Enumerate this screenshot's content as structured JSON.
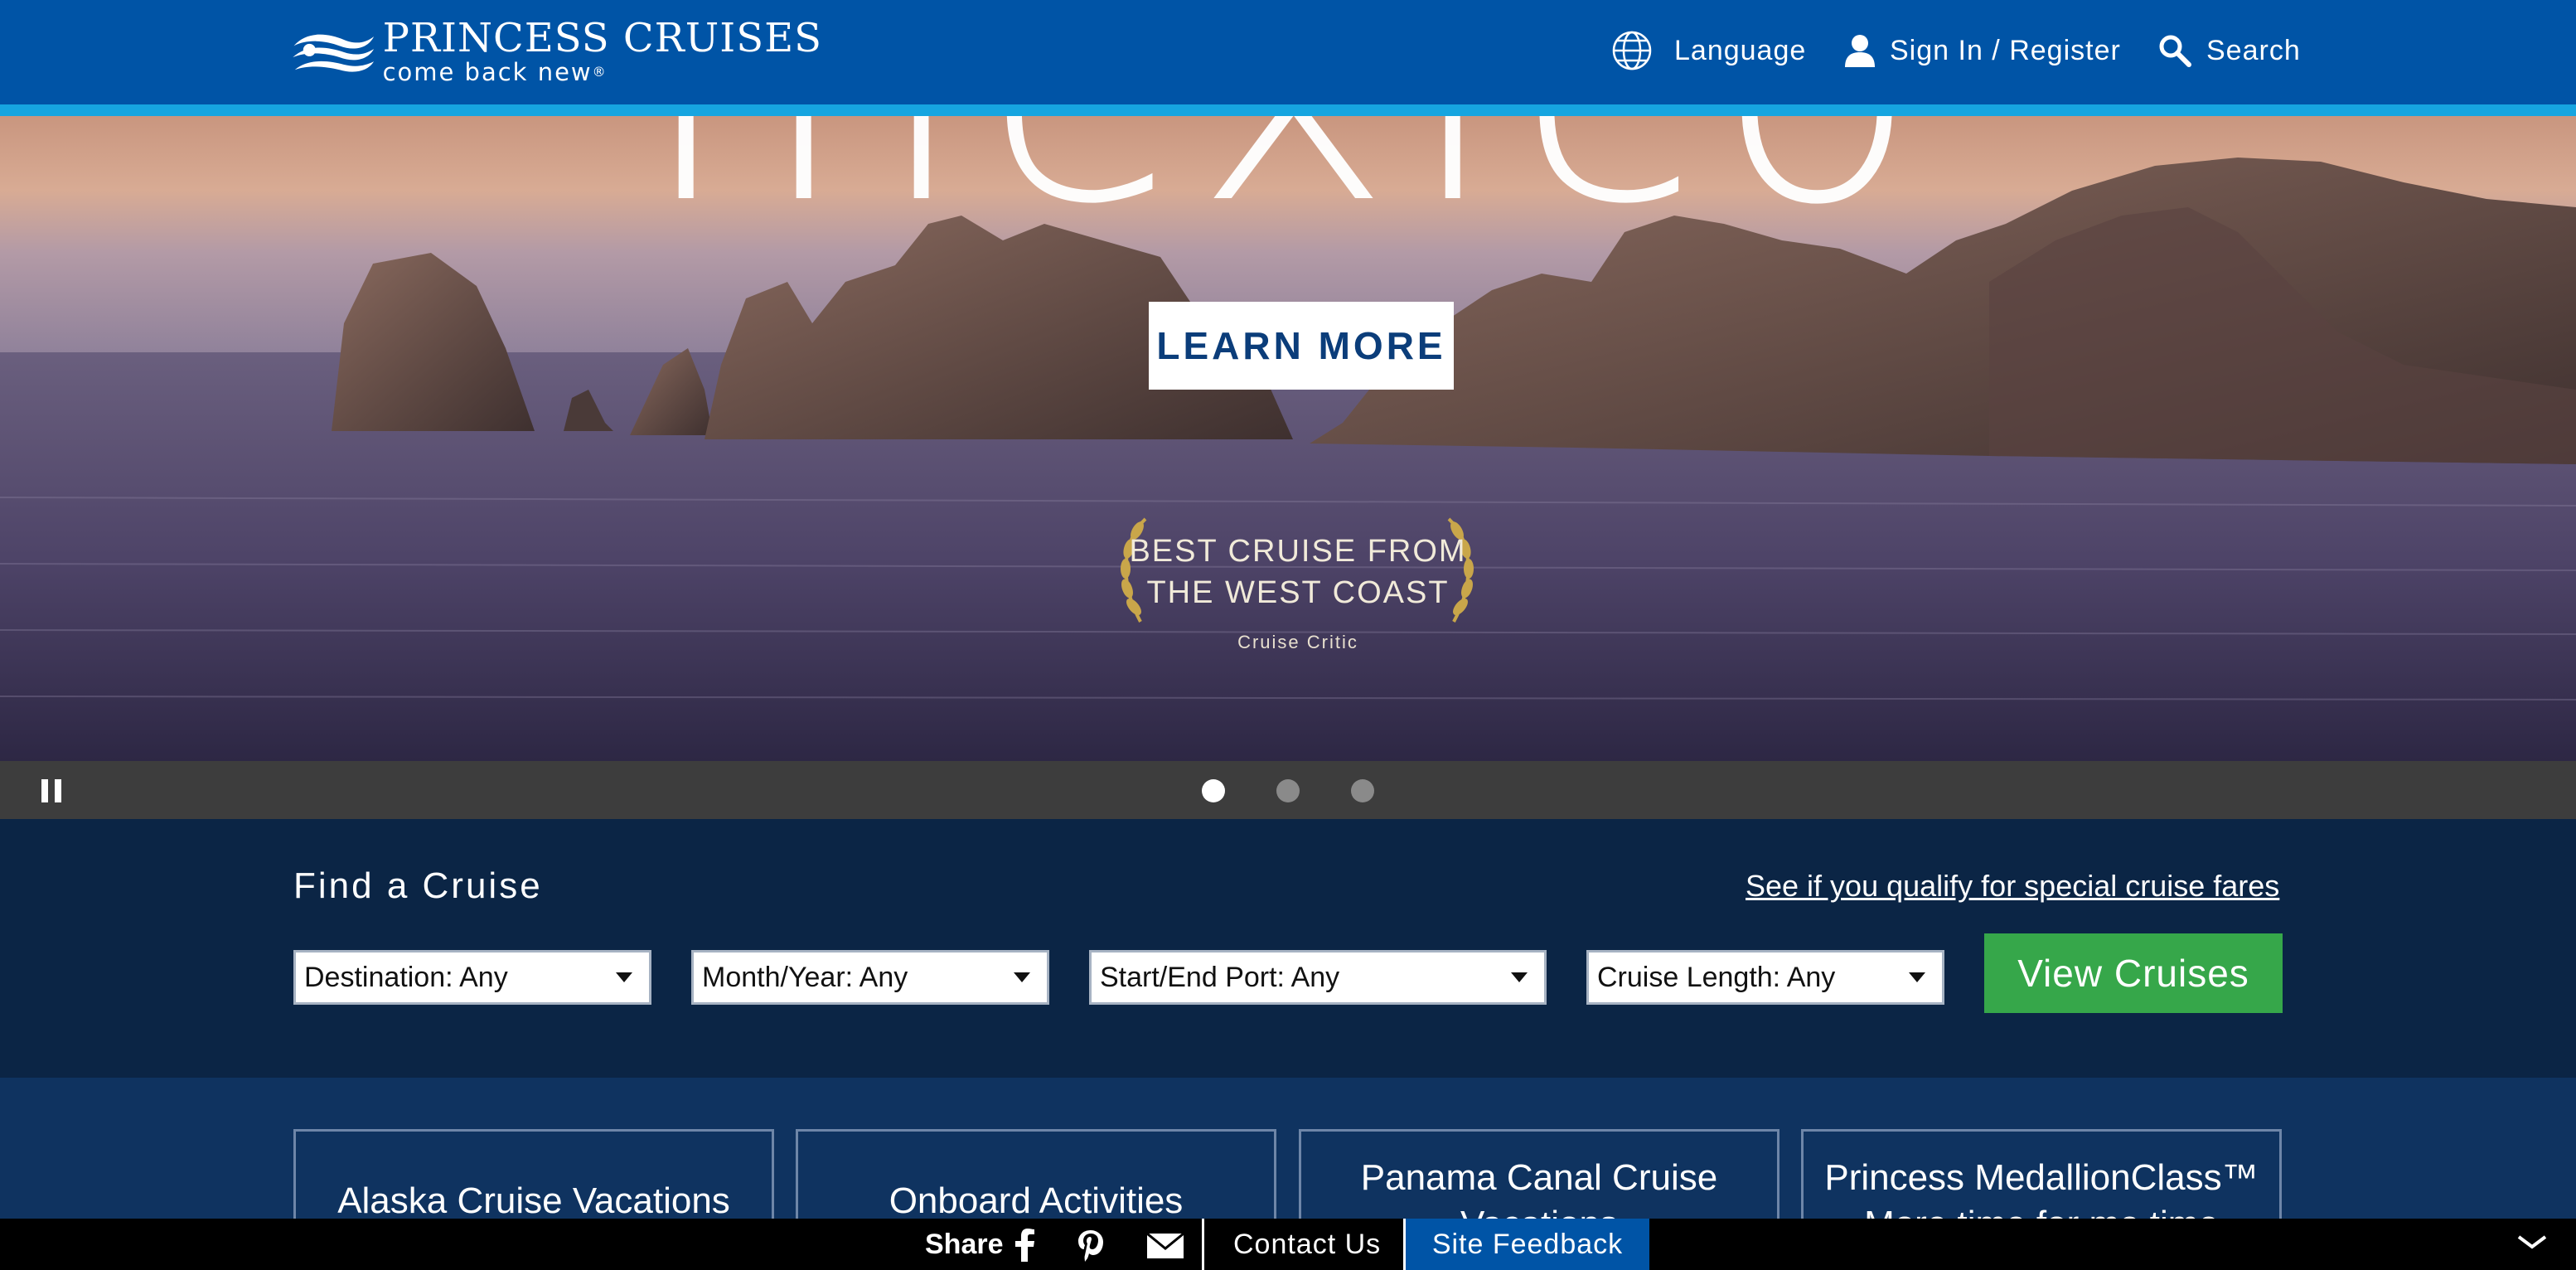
{
  "header": {
    "brand": "PRINCESS CRUISES",
    "tagline": "come back new",
    "tagline_mark": "®",
    "nav": {
      "language": "Language",
      "sign_in": "Sign In / Register",
      "search": "Search"
    },
    "colors": {
      "bar": "#0054a6",
      "strip": "#16a5e0"
    }
  },
  "hero": {
    "title": "mexico",
    "cta": "LEARN MORE",
    "award": {
      "line1": "BEST CRUISE FROM",
      "line2": "THE WEST COAST",
      "source": "Cruise Critic"
    },
    "carousel": {
      "slides": 3,
      "active": 1,
      "control": "pause-icon"
    }
  },
  "finder": {
    "title": "Find a Cruise",
    "special_link": "See if you qualify for special cruise fares",
    "selects": {
      "destination": "Destination: Any",
      "month_year": "Month/Year: Any",
      "port": "Start/End Port: Any",
      "length": "Cruise Length: Any"
    },
    "submit": "View Cruises",
    "submit_color": "#36a74a"
  },
  "cards": [
    {
      "label": "Alaska Cruise Vacations"
    },
    {
      "label": "Onboard Activities"
    },
    {
      "label": "Panama Canal Cruise Vacations"
    },
    {
      "label": "Princess MedallionClass™ More time for me time"
    }
  ],
  "footer": {
    "share": "Share",
    "icons": [
      "facebook-icon",
      "pinterest-icon",
      "mail-icon"
    ],
    "contact": "Contact Us",
    "feedback": "Site Feedback",
    "collapse": "chevron-down-icon"
  }
}
